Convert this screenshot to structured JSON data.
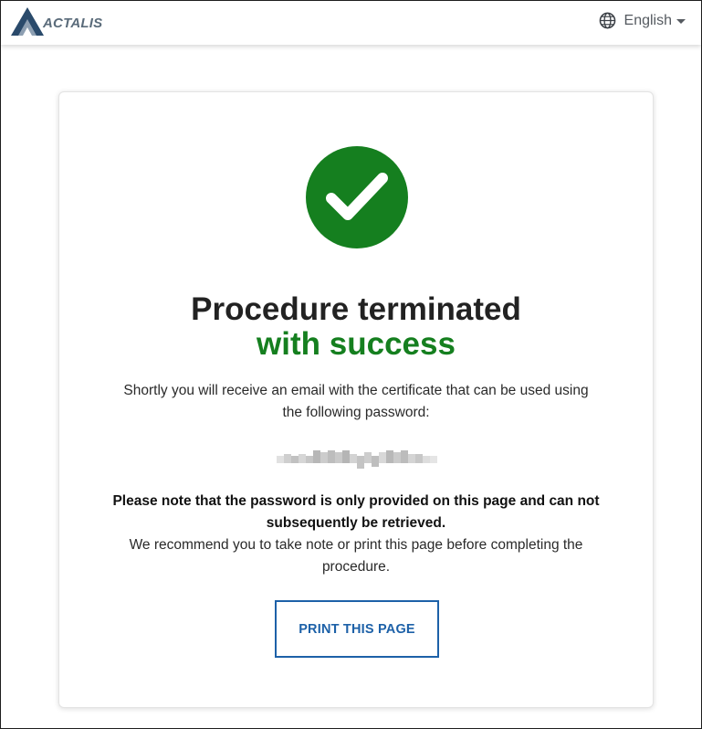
{
  "header": {
    "logo_text": "ACTALIS",
    "language_label": "English",
    "language_icon": "globe-icon"
  },
  "card": {
    "status_icon": "checkmark-icon",
    "status_color": "#157f1f",
    "title_line1": "Procedure terminated",
    "title_line2": "with success",
    "message": "Shortly you will receive an email with the certificate that can be used using the following password:",
    "password_display": "[blurred password]",
    "note_bold": "Please note that the password is only provided on this page and can not subsequently be retrieved.",
    "note_text": "We recommend you to take note or print this page before completing the procedure.",
    "print_button_label": "PRINT THIS PAGE"
  },
  "colors": {
    "brand_dark": "#2a4a6b",
    "brand_light": "#7a8ea3",
    "success": "#157f1f",
    "link_blue": "#1d61a8"
  }
}
